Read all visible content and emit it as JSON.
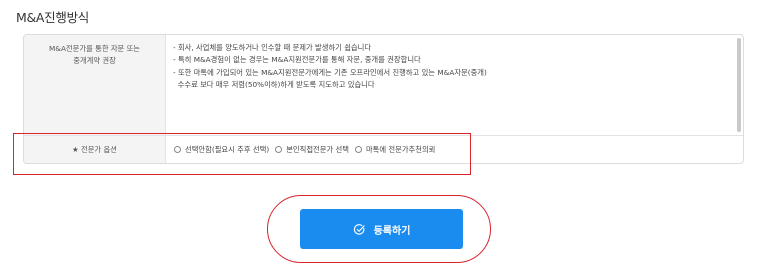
{
  "section": {
    "title": "M&A진행방식"
  },
  "consult": {
    "label_line1": "M&A전문가를 통한 자문 또는",
    "label_line2": "중개계약 권장",
    "lines": [
      "- 회사, 사업체를 양도하거나 인수할 때 문제가 발생하기 쉽습니다",
      "- 특히 M&A경험이 없는 경우는 M&A지원전문가를 통해 자문, 중개를 권장합니다",
      "- 또한 마톡에 가입되어 있는 M&A지원전문가에게는 기존 오프라인에서 진행하고 있는 M&A자문(중개)",
      "  수수료 보다 매우 저렴(50%이하)하게 받도록 지도하고 있습니다"
    ]
  },
  "expert_option": {
    "label": "★ 전문가 옵션",
    "options": [
      {
        "label": "선택안함(필요시 추후 선택)"
      },
      {
        "label": "본인직접전문가 선택"
      },
      {
        "label": "마톡에 전문가추천의뢰"
      }
    ]
  },
  "submit": {
    "label": "등록하기",
    "icon": "check-circle-icon"
  },
  "colors": {
    "primary_button": "#1a8cf0",
    "highlight": "#d9232d"
  }
}
